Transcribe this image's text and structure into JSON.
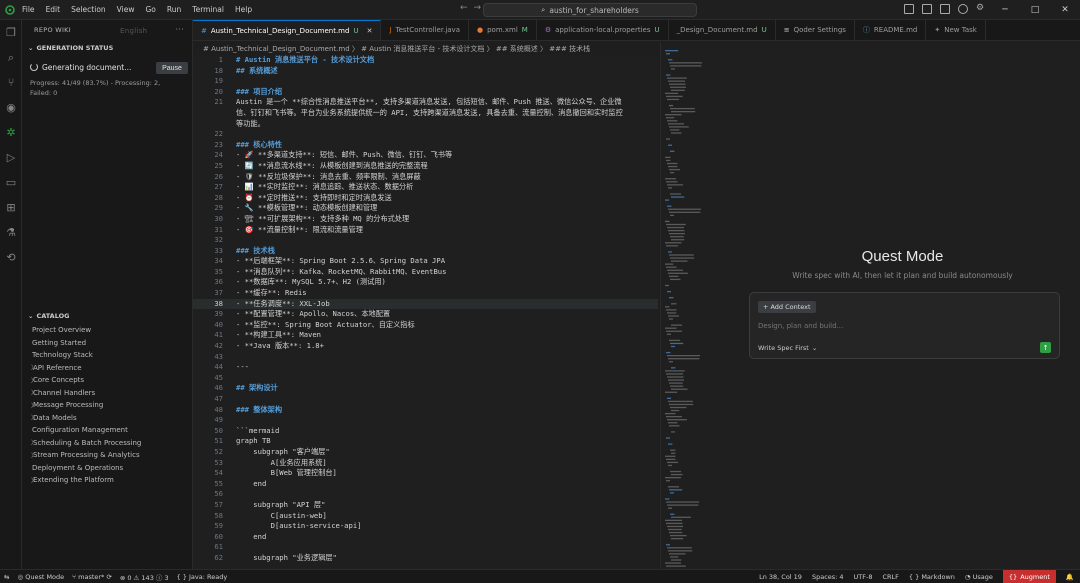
{
  "titlebar": {
    "menu": [
      "File",
      "Edit",
      "Selection",
      "View",
      "Go",
      "Run",
      "Terminal",
      "Help"
    ],
    "search": "austin_for_shareholders"
  },
  "sidebar": {
    "header": "REPO WIKI",
    "language": "English",
    "generation_title": "GENERATION STATUS",
    "generating_label": "Generating document...",
    "pause_label": "Pause",
    "progress_text": "Progress: 41/49 (83.7%) - Processing: 2, Failed: 0",
    "catalog_title": "CATALOG",
    "catalog": [
      {
        "label": "Project Overview",
        "expandable": false
      },
      {
        "label": "Getting Started",
        "expandable": false
      },
      {
        "label": "Technology Stack",
        "expandable": false
      },
      {
        "label": "API Reference",
        "expandable": true
      },
      {
        "label": "Core Concepts",
        "expandable": true
      },
      {
        "label": "Channel Handlers",
        "expandable": true
      },
      {
        "label": "Message Processing",
        "expandable": true
      },
      {
        "label": "Data Models",
        "expandable": true
      },
      {
        "label": "Configuration Management",
        "expandable": false
      },
      {
        "label": "Scheduling & Batch Processing",
        "expandable": true
      },
      {
        "label": "Stream Processing & Analytics",
        "expandable": true
      },
      {
        "label": "Deployment & Operations",
        "expandable": false
      },
      {
        "label": "Extending the Platform",
        "expandable": true
      }
    ]
  },
  "tabs": [
    {
      "label": "Austin_Technical_Design_Document.md",
      "suffix": "U",
      "icon": "#",
      "color": "#519aba",
      "active": true
    },
    {
      "label": "TestController.java",
      "suffix": "",
      "icon": "J",
      "color": "#e76f00",
      "active": false
    },
    {
      "label": "pom.xml",
      "suffix": "M",
      "icon": "●",
      "color": "#e37933",
      "active": false
    },
    {
      "label": "application-local.properties",
      "suffix": "U",
      "icon": "⚙",
      "color": "#a074c4",
      "active": false
    },
    {
      "label": "_Design_Document.md",
      "suffix": "U",
      "icon": "",
      "color": "#519aba",
      "active": false
    },
    {
      "label": "Qoder Settings",
      "suffix": "",
      "icon": "≡",
      "color": "#cccccc",
      "active": false
    },
    {
      "label": "README.md",
      "suffix": "",
      "icon": "ⓘ",
      "color": "#519aba",
      "active": false
    },
    {
      "label": "New Task",
      "suffix": "",
      "icon": "✦",
      "color": "#888888",
      "active": false
    }
  ],
  "breadcrumb": "# Austin_Technical_Design_Document.md 〉 # Austin 消息推送平台 - 技术设计文档 〉 ## 系统概述 〉 ### 技术栈",
  "code_lines": [
    {
      "n": "1",
      "kind": "h",
      "text": "# Austin 消息推送平台 - 技术设计文档"
    },
    {
      "n": "18",
      "kind": "h",
      "text": "## 系统概述"
    },
    {
      "n": "19",
      "kind": "",
      "text": ""
    },
    {
      "n": "20",
      "kind": "h",
      "text": "### 项目介绍"
    },
    {
      "n": "21",
      "kind": "",
      "text": "Austin 是一个 **综合性消息推送平台**, 支持多渠道消息发送, 包括短信、邮件、Push 推送、微信公众号、企业微"
    },
    {
      "n": "",
      "kind": "",
      "text": "信、钉钉和飞书等。平台为业务系统提供统一的 API, 支持跨渠道消息发送, 具备去重、流量控制、消息撤回和实时监控"
    },
    {
      "n": "",
      "kind": "",
      "text": "等功能。"
    },
    {
      "n": "22",
      "kind": "",
      "text": ""
    },
    {
      "n": "23",
      "kind": "h",
      "text": "### 核心特性"
    },
    {
      "n": "24",
      "kind": "li",
      "text": "- 🚀 **多渠道支持**: 短信、邮件、Push、微信、钉钉、飞书等"
    },
    {
      "n": "25",
      "kind": "li",
      "text": "- 🔄 **消息流水线**: 从模板创建到消息推送的完整流程"
    },
    {
      "n": "26",
      "kind": "li",
      "text": "- 🛡 **反垃圾保护**: 消息去重、频率限制、消息屏蔽"
    },
    {
      "n": "27",
      "kind": "li",
      "text": "- 📊 **实时监控**: 消息追踪、推送状态、数据分析"
    },
    {
      "n": "28",
      "kind": "li",
      "text": "- ⏰ **定时推送**: 支持即时和定时消息发送"
    },
    {
      "n": "29",
      "kind": "li",
      "text": "- 🔧 **模板管理**: 动态模板创建和管理"
    },
    {
      "n": "30",
      "kind": "li",
      "text": "- 🏗 **可扩展架构**: 支持多种 MQ 的分布式处理"
    },
    {
      "n": "31",
      "kind": "li",
      "text": "- 🎯 **流量控制**: 限流和流量管理"
    },
    {
      "n": "32",
      "kind": "",
      "text": ""
    },
    {
      "n": "33",
      "kind": "h",
      "text": "### 技术栈"
    },
    {
      "n": "34",
      "kind": "li",
      "text": "- **后端框架**: Spring Boot 2.5.6、Spring Data JPA"
    },
    {
      "n": "35",
      "kind": "li",
      "text": "- **消息队列**: Kafka、RocketMQ、RabbitMQ、EventBus"
    },
    {
      "n": "36",
      "kind": "li",
      "text": "- **数据库**: MySQL 5.7+、H2 (测试用)"
    },
    {
      "n": "37",
      "kind": "li",
      "text": "- **缓存**: Redis"
    },
    {
      "n": "38",
      "kind": "li",
      "text": "- **任务调度**: XXL-Job",
      "cursor": true
    },
    {
      "n": "39",
      "kind": "li",
      "text": "- **配置管理**: Apollo、Nacos、本地配置"
    },
    {
      "n": "40",
      "kind": "li",
      "text": "- **监控**: Spring Boot Actuator、自定义指标"
    },
    {
      "n": "41",
      "kind": "li",
      "text": "- **构建工具**: Maven"
    },
    {
      "n": "42",
      "kind": "li",
      "text": "- **Java 版本**: 1.8+"
    },
    {
      "n": "43",
      "kind": "",
      "text": ""
    },
    {
      "n": "44",
      "kind": "",
      "text": "---"
    },
    {
      "n": "45",
      "kind": "",
      "text": ""
    },
    {
      "n": "46",
      "kind": "h",
      "text": "## 架构设计"
    },
    {
      "n": "47",
      "kind": "",
      "text": ""
    },
    {
      "n": "48",
      "kind": "h",
      "text": "### 整体架构"
    },
    {
      "n": "49",
      "kind": "",
      "text": ""
    },
    {
      "n": "50",
      "kind": "",
      "text": "```mermaid"
    },
    {
      "n": "51",
      "kind": "",
      "text": "graph TB"
    },
    {
      "n": "52",
      "kind": "",
      "text": "    subgraph \"客户端层\""
    },
    {
      "n": "53",
      "kind": "",
      "text": "        A[业务应用系统]"
    },
    {
      "n": "54",
      "kind": "",
      "text": "        B[Web 管理控制台]"
    },
    {
      "n": "55",
      "kind": "",
      "text": "    end"
    },
    {
      "n": "56",
      "kind": "",
      "text": ""
    },
    {
      "n": "57",
      "kind": "",
      "text": "    subgraph \"API 层\""
    },
    {
      "n": "58",
      "kind": "",
      "text": "        C[austin-web]"
    },
    {
      "n": "59",
      "kind": "",
      "text": "        D[austin-service-api]"
    },
    {
      "n": "60",
      "kind": "",
      "text": "    end"
    },
    {
      "n": "61",
      "kind": "",
      "text": ""
    },
    {
      "n": "62",
      "kind": "",
      "text": "    subgraph \"业务逻辑层\""
    }
  ],
  "quest": {
    "title": "Quest Mode",
    "subtitle": "Write spec with AI, then let it plan and build autonomously",
    "add_context": "Add Context",
    "placeholder": "Design, plan and build...",
    "spec_label": "Write Spec First"
  },
  "statusbar": {
    "quest": "Quest Mode",
    "branch": "master*",
    "problems": "⊗ 0 ⚠ 143 ⓘ 3",
    "java": "Java: Ready",
    "position": "Ln 38, Col 19",
    "spaces": "Spaces: 4",
    "encoding": "UTF-8",
    "eol": "CRLF",
    "language": "Markdown",
    "usage": "Usage",
    "augment": "Augment"
  },
  "colors": {
    "accent": "#0078d4",
    "heading": "#569cd6",
    "send": "#2ea043",
    "augment": "#c72e2e"
  }
}
